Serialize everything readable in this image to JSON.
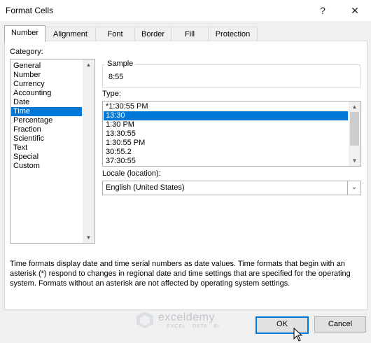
{
  "window": {
    "title": "Format Cells",
    "help_glyph": "?",
    "close_glyph": "✕"
  },
  "tabs": [
    {
      "label": "Number",
      "active": true
    },
    {
      "label": "Alignment",
      "active": false
    },
    {
      "label": "Font",
      "active": false
    },
    {
      "label": "Border",
      "active": false
    },
    {
      "label": "Fill",
      "active": false
    },
    {
      "label": "Protection",
      "active": false
    }
  ],
  "category": {
    "label": "Category:",
    "items": [
      "General",
      "Number",
      "Currency",
      "Accounting",
      "Date",
      "Time",
      "Percentage",
      "Fraction",
      "Scientific",
      "Text",
      "Special",
      "Custom"
    ],
    "selected": "Time"
  },
  "sample": {
    "label": "Sample",
    "value": "8:55"
  },
  "type": {
    "label": "Type:",
    "items": [
      "*1:30:55 PM",
      "13:30",
      "1:30 PM",
      "13:30:55",
      "1:30:55 PM",
      "30:55.2",
      "37:30:55"
    ],
    "selected": "13:30"
  },
  "locale": {
    "label": "Locale (location):",
    "value": "English (United States)"
  },
  "description": "Time formats display date and time serial numbers as date values.  Time formats that begin with an asterisk (*) respond to changes in regional date and time settings that are specified for the operating system. Formats without an asterisk are not affected by operating system settings.",
  "buttons": {
    "ok": "OK",
    "cancel": "Cancel"
  },
  "watermark": {
    "name": "exceldemy",
    "tagline": "EXCEL · DATA · BI"
  },
  "colors": {
    "selection": "#0078d7",
    "default_button_border": "#0078d7"
  }
}
